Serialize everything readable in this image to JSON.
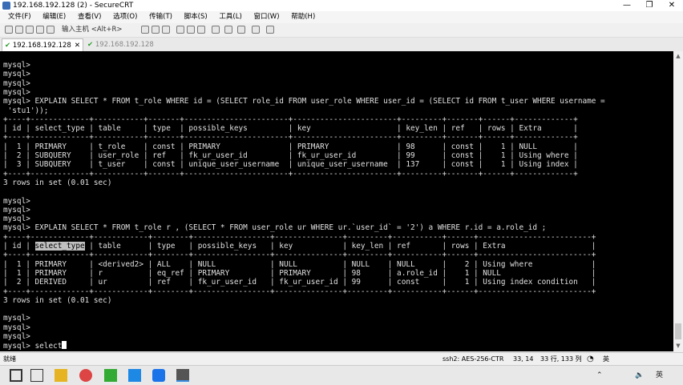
{
  "window": {
    "title": "192.168.192.128 (2) - SecureCRT",
    "min": "—",
    "max": "❐",
    "close": "✕"
  },
  "menu": [
    "文件(F)",
    "编辑(E)",
    "查看(V)",
    "选项(O)",
    "传输(T)",
    "脚本(S)",
    "工具(L)",
    "窗口(W)",
    "帮助(H)"
  ],
  "toolbar": {
    "quick_connect_placeholder": "输入主机 <Alt+R>"
  },
  "tabs": [
    {
      "label": "192.168.192.128 (2)",
      "close": "✕",
      "active": true
    },
    {
      "label": "192.168.192.128",
      "active": false
    }
  ],
  "tab_nav": "◁ ▷",
  "terminal": {
    "lines": [
      "mysql>",
      "mysql>",
      "mysql>",
      "mysql>",
      "mysql> EXPLAIN SELECT * FROM t_role WHERE id = (SELECT role_id FROM user_role WHERE user_id = (SELECT id FROM t_user WHERE username =",
      " 'stu1'));",
      "+----+-------------+-----------+-------+-----------------------+-----------------------+---------+-------+------+-------------+",
      "| id | select_type | table     | type  | possible_keys         | key                   | key_len | ref   | rows | Extra       |",
      "+----+-------------+-----------+-------+-----------------------+-----------------------+---------+-------+------+-------------+",
      "|  1 | PRIMARY     | t_role    | const | PRIMARY               | PRIMARY               | 98      | const |    1 | NULL        |",
      "|  2 | SUBQUERY    | user_role | ref   | fk_ur_user_id         | fk_ur_user_id         | 99      | const |    1 | Using where |",
      "|  3 | SUBQUERY    | t_user    | const | unique_user_username  | unique_user_username  | 137     | const |    1 | Using index |",
      "+----+-------------+-----------+-------+-----------------------+-----------------------+---------+-------+------+-------------+",
      "3 rows in set (0.01 sec)",
      "",
      "mysql>",
      "mysql>",
      "mysql>",
      "mysql> EXPLAIN SELECT * FROM t_role r , (SELECT * FROM user_role ur WHERE ur.`user_id` = '2') a WHERE r.id = a.role_id ;",
      "+----+-------------+------------+--------+-----------------+---------------+---------+-----------+------+-------------------------+",
      "| id | select_type | table      | type   | possible_keys   | key           | key_len | ref       | rows | Extra                   |",
      "+----+-------------+------------+--------+-----------------+---------------+---------+-----------+------+-------------------------+",
      "|  1 | PRIMARY     | <derived2> | ALL    | NULL            | NULL          | NULL    | NULL      |    2 | Using where             |",
      "|  1 | PRIMARY     | r          | eq_ref | PRIMARY         | PRIMARY       | 98      | a.role_id |    1 | NULL                    |",
      "|  2 | DERIVED     | ur         | ref    | fk_ur_user_id   | fk_ur_user_id | 99      | const     |    1 | Using index condition   |",
      "+----+-------------+------------+--------+-----------------+---------------+---------+-----------+------+-------------------------+",
      "3 rows in set (0.01 sec)",
      "",
      "mysql>",
      "mysql>",
      "mysql>",
      "mysql> select"
    ]
  },
  "status": {
    "ready": "就绪",
    "cipher": "ssh2: AES-256-CTR",
    "position": "33, 14",
    "size": "33 行, 133 列",
    "ime": "英"
  },
  "taskbar": {
    "clock": "英"
  }
}
